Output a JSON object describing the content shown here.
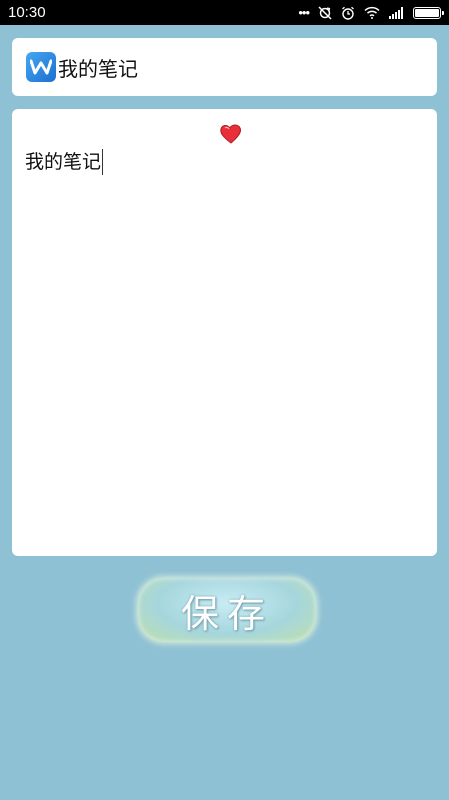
{
  "status_bar": {
    "time": "10:30",
    "icons": [
      "more-dots-icon",
      "sync-off-icon",
      "alarm-icon",
      "wifi-icon",
      "signal-icon",
      "battery-icon"
    ],
    "battery_level": 1.0
  },
  "header": {
    "app_icon": "wps-logo-icon",
    "title": "我的笔记"
  },
  "editor": {
    "content": "我的笔记",
    "decoration": "heart-icon"
  },
  "actions": {
    "save_label": "保存"
  },
  "colors": {
    "background": "#8fc1d4",
    "card": "#ffffff",
    "logo": "#1b6fd1",
    "heart": "#e8303a"
  }
}
